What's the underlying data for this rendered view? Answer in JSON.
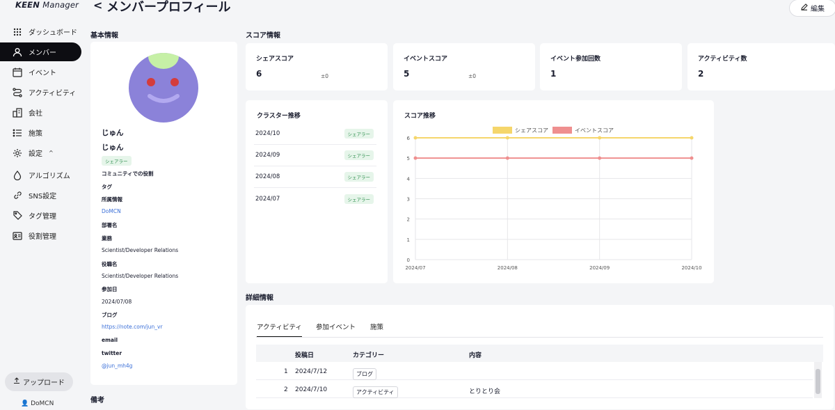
{
  "app": {
    "logo_main": "KEEN",
    "logo_sub": "Manager"
  },
  "header": {
    "back": "<",
    "title": "メンバープロフィール",
    "edit_label": "編集"
  },
  "sidebar": {
    "items": [
      {
        "label": "ダッシュボード",
        "icon": "grid-icon"
      },
      {
        "label": "メンバー",
        "icon": "person-icon"
      },
      {
        "label": "イベント",
        "icon": "calendar-icon"
      },
      {
        "label": "アクティビティ",
        "icon": "route-icon"
      },
      {
        "label": "会社",
        "icon": "building-icon"
      },
      {
        "label": "施策",
        "icon": "list-icon"
      },
      {
        "label": "設定",
        "icon": "gear-icon"
      },
      {
        "label": "アルゴリズム",
        "icon": "drop-icon"
      },
      {
        "label": "SNS設定",
        "icon": "link-icon"
      },
      {
        "label": "タグ管理",
        "icon": "tag-icon"
      },
      {
        "label": "役割管理",
        "icon": "id-card-icon"
      }
    ],
    "settings_chevron": "^",
    "upload_label": "アップロード",
    "org": "DoMCN"
  },
  "profile": {
    "section_title": "基本情報",
    "name1": "じゅん",
    "name2": "じゅん",
    "badge": "シェアラー",
    "role_label": "コミュニティでの役割",
    "tag_label": "タグ",
    "affiliation_label": "所属情報",
    "affiliation_value": "DoMCN",
    "dept_label": "部署名",
    "job_label": "業務",
    "job_value": "Scientist/Developer Relations",
    "title_label": "役職名",
    "title_value": "Scientist/Developer Relations",
    "joined_label": "参加日",
    "joined_value": "2024/07/08",
    "blog_label": "ブログ",
    "blog_value": "https://note.com/jun_vr",
    "email_label": "email",
    "twitter_label": "twitter",
    "twitter_value": "@jun_mh4g",
    "notes_title": "備考"
  },
  "scores": {
    "section_title": "スコア情報",
    "cards": [
      {
        "label": "シェアスコア",
        "value": "6",
        "delta": "±0"
      },
      {
        "label": "イベントスコア",
        "value": "5",
        "delta": "±0"
      },
      {
        "label": "イベント参加回数",
        "value": "1"
      },
      {
        "label": "アクティビティ数",
        "value": "2"
      }
    ]
  },
  "cluster": {
    "title": "クラスター推移",
    "rows": [
      {
        "month": "2024/10",
        "badge": "シェアラー"
      },
      {
        "month": "2024/09",
        "badge": "シェアラー"
      },
      {
        "month": "2024/08",
        "badge": "シェアラー"
      },
      {
        "month": "2024/07",
        "badge": "シェアラー"
      }
    ]
  },
  "chart_data": {
    "type": "line",
    "title": "スコア推移",
    "categories": [
      "2024/07",
      "2024/08",
      "2024/09",
      "2024/10"
    ],
    "series": [
      {
        "name": "シェアスコア",
        "values": [
          6,
          6,
          6,
          6
        ],
        "color": "#f5d66b"
      },
      {
        "name": "イベントスコア",
        "values": [
          5,
          5,
          5,
          5
        ],
        "color": "#ef8f8f"
      }
    ],
    "ylim": [
      0,
      6
    ],
    "yticks": [
      "0",
      "1",
      "2",
      "3",
      "4",
      "5",
      "6"
    ],
    "legend": "top",
    "grid": true
  },
  "detail": {
    "section_title": "詳細情報",
    "tabs": [
      "アクティビティ",
      "参加イベント",
      "施策"
    ],
    "columns": [
      "投稿日",
      "カテゴリー",
      "内容"
    ],
    "rows": [
      {
        "index": "1",
        "date": "2024/7/12",
        "category": "ブログ",
        "content": ""
      },
      {
        "index": "2",
        "date": "2024/7/10",
        "category": "アクティビティ",
        "content": "とりとり会"
      }
    ]
  },
  "colors": {
    "active_nav": "#0d0d12",
    "badge_green": "#2f8f4e",
    "link": "#3a6fd8",
    "avatar": "#8b82d9"
  }
}
